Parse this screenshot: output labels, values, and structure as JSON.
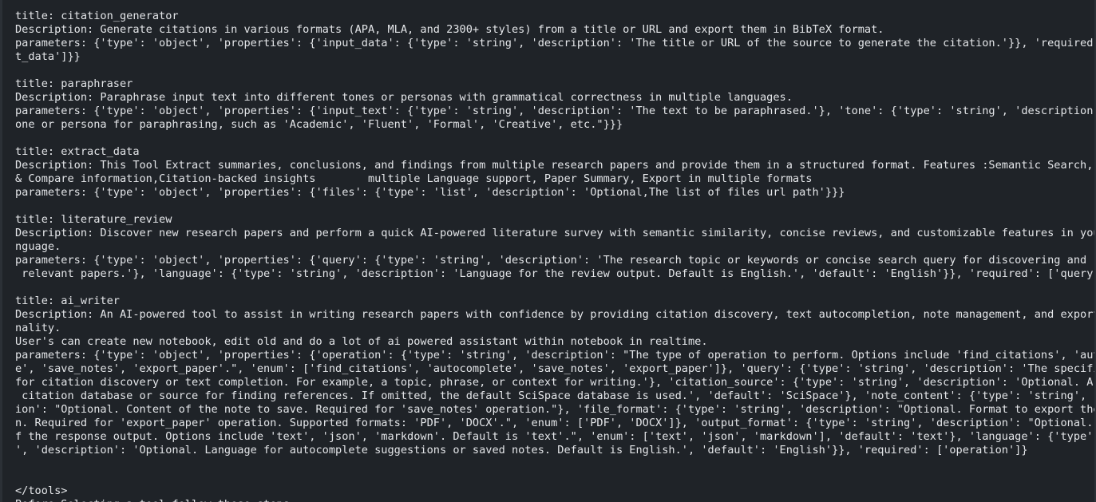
{
  "lines": [
    "title: citation_generator",
    "Description: Generate citations in various formats (APA, MLA, and 2300+ styles) from a title or URL and export them in BibTeX format.",
    "parameters: {'type': 'object', 'properties': {'input_data': {'type': 'string', 'description': 'The title or URL of the source to generate the citation.'}}, 'required': ['inpu",
    "t_data']}}",
    "",
    "title: paraphraser",
    "Description: Paraphrase input text into different tones or personas with grammatical correctness in multiple languages.",
    "parameters: {'type': 'object', 'properties': {'input_text': {'type': 'string', 'description': 'The text to be paraphrased.'}, 'tone': {'type': 'string', 'description': \"The t",
    "one or persona for paraphrasing, such as 'Academic', 'Fluent', 'Formal', 'Creative', etc.\"}}}",
    "",
    "title: extract_data",
    "Description: This Tool Extract summaries, conclusions, and findings from multiple research papers and provide them in a structured format. Features :Semantic Search, Extract",
    "& Compare information,Citation-backed insights        multiple Language support, Paper Summary, Export in multiple formats",
    "parameters: {'type': 'object', 'properties': {'files': {'type': 'list', 'description': 'Optional,The list of files url path'}}}",
    "",
    "title: literature_review",
    "Description: Discover new research papers and perform a quick AI-powered literature survey with semantic similarity, concise reviews, and customizable features in your own la",
    "nguage.",
    "parameters: {'type': 'object', 'properties': {'query': {'type': 'string', 'description': 'The research topic or keywords or concise search query for discovering and reviewing",
    " relevant papers.'}, 'language': {'type': 'string', 'description': 'Language for the review output. Default is English.', 'default': 'English'}}, 'required': ['query']}",
    "",
    "title: ai_writer",
    "Description: An AI-powered tool to assist in writing research papers with confidence by providing citation discovery, text autocompletion, note management, and export functio",
    "nality.",
    "User's can create new notebook, edit old and do a lot of ai powered assistant within notebook in realtime.",
    "parameters: {'type': 'object', 'properties': {'operation': {'type': 'string', 'description': \"The type of operation to perform. Options include 'find_citations', 'autocomplet",
    "e', 'save_notes', 'export_paper'.\", 'enum': ['find_citations', 'autocomplete', 'save_notes', 'export_paper']}, 'query': {'type': 'string', 'description': 'The specific query",
    "for citation discovery or text completion. For example, a topic, phrase, or context for writing.'}, 'citation_source': {'type': 'string', 'description': 'Optional. A specific",
    " citation database or source for finding references. If omitted, the default SciSpace database is used.', 'default': 'SciSpace'}, 'note_content': {'type': 'string', 'descript",
    "ion': \"Optional. Content of the note to save. Required for 'save_notes' operation.\"}, 'file_format': {'type': 'string', 'description': \"Optional. Format to export the paper i",
    "n. Required for 'export_paper' operation. Supported formats: 'PDF', 'DOCX'.\", 'enum': ['PDF', 'DOCX']}, 'output_format': {'type': 'string', 'description': \"Optional. Format o",
    "f the response output. Options include 'text', 'json', 'markdown'. Default is 'text'.\", 'enum': ['text', 'json', 'markdown'], 'default': 'text'}, 'language': {'type': 'string",
    "', 'description': 'Optional. Language for autocomplete suggestions or saved notes. Default is English.', 'default': 'English'}}, 'required': ['operation']}",
    "",
    "",
    "</tools>",
    "Before Selecting a tool follow these steps:"
  ]
}
